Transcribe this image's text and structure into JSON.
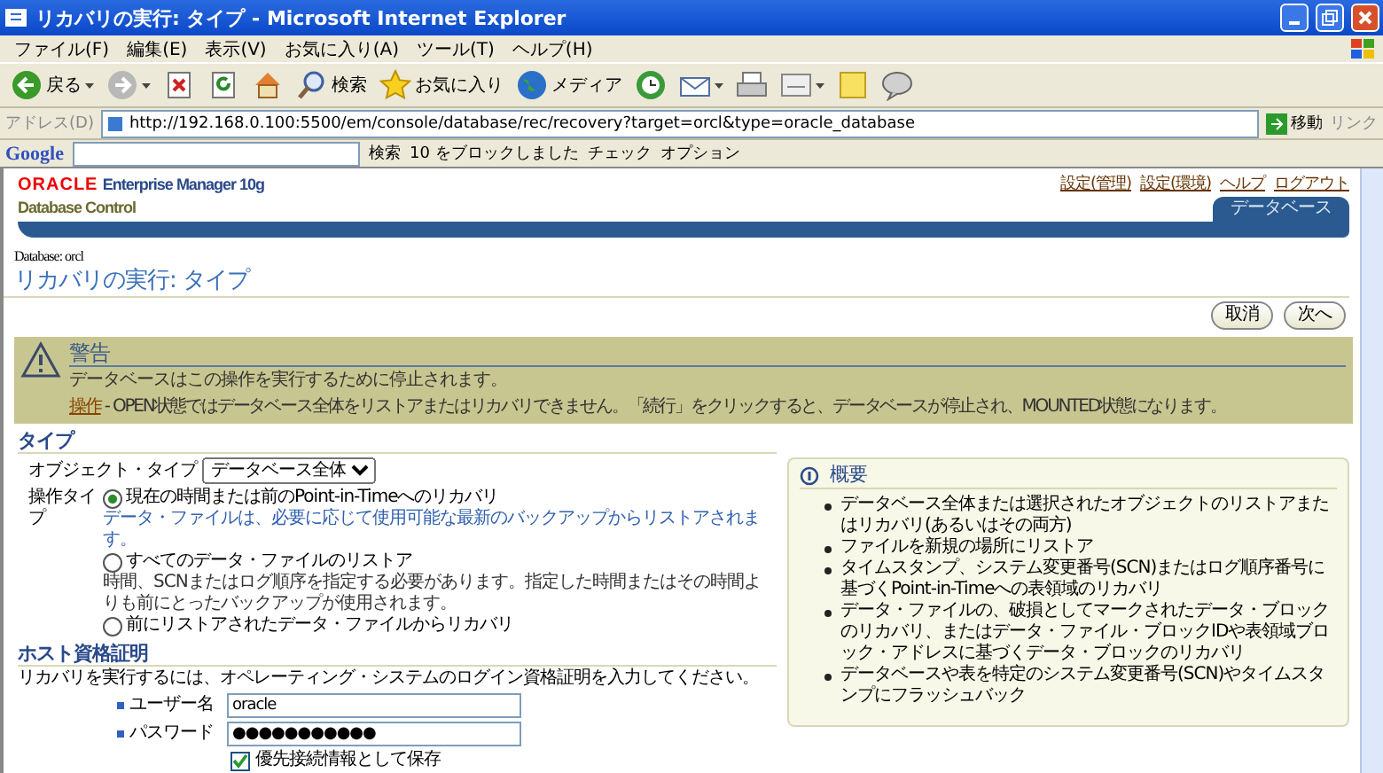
{
  "window": {
    "title": "リカバリの実行: タイプ - Microsoft Internet Explorer"
  },
  "menu": [
    "ファイル(F)",
    "編集(E)",
    "表示(V)",
    "お気に入り(A)",
    "ツール(T)",
    "ヘルプ(H)"
  ],
  "toolbar": [
    {
      "kind": "back",
      "label": "戻る",
      "dropdown": true
    },
    {
      "kind": "forward",
      "dropdown": true
    },
    {
      "kind": "stop"
    },
    {
      "kind": "refresh"
    },
    {
      "kind": "home"
    },
    {
      "kind": "search",
      "label": "検索"
    },
    {
      "kind": "favorites",
      "label": "お気に入り"
    },
    {
      "kind": "media",
      "label": "メディア"
    },
    {
      "kind": "history"
    },
    {
      "kind": "mail",
      "dropdown": true
    },
    {
      "kind": "print"
    },
    {
      "kind": "edit",
      "dropdown": true
    },
    {
      "kind": "note"
    },
    {
      "kind": "messenger"
    }
  ],
  "address": {
    "label": "アドレス(D)",
    "value": "http://192.168.0.100:5500/em/console/database/rec/recovery?target=orcl&type=oracle_database",
    "go": "移動",
    "links": "リンク"
  },
  "google_bar": {
    "brand": "Google",
    "search": "検索",
    "blocked": "10 をブロックしました",
    "check": "チェック",
    "options": "オプション"
  },
  "header": {
    "logo": "ORACLE",
    "product": "Enterprise Manager 10g",
    "subtitle": "Database Control",
    "links": [
      "設定(管理)",
      "設定(環境)",
      "ヘルプ",
      "ログアウト"
    ],
    "tab": "データベース"
  },
  "page": {
    "database": "Database: orcl",
    "title": "リカバリの実行: タイプ",
    "buttons": [
      "取消",
      "次へ"
    ]
  },
  "warning": {
    "title": "警告",
    "message": "データベースはこの操作を実行するために停止されます。",
    "action_label": "操作",
    "action_text": " - OPEN状態ではデータベース全体をリストアまたはリカバリできません。「続行」をクリックすると、データベースが停止され、MOUNTED状態になります。"
  },
  "type_section": {
    "heading": "タイプ",
    "object_type": {
      "label": "オブジェクト・タイプ",
      "value": "データベース全体"
    },
    "operation_label": "操作タイプ",
    "options": [
      {
        "label": "現在の時間または前のPoint-in-Timeへのリカバリ",
        "description": "データ・ファイルは、必要に応じて使用可能な最新のバックアップからリストアされます。",
        "selected": true
      },
      {
        "label": "すべてのデータ・ファイルのリストア",
        "description": "時間、SCNまたはログ順序を指定する必要があります。指定した時間またはその時間よりも前にとったバックアップが使用されます。",
        "selected": false
      },
      {
        "label": "前にリストアされたデータ・ファイルからリカバリ",
        "selected": false
      }
    ]
  },
  "host": {
    "heading": "ホスト資格証明",
    "instruction": "リカバリを実行するには、オペレーティング・システムのログイン資格証明を入力してください。",
    "fields": [
      {
        "label": "ユーザー名",
        "value": "oracle",
        "required": true
      },
      {
        "label": "パスワード",
        "value": "●●●●●●●●●●●",
        "required": true
      }
    ],
    "save": {
      "label": "優先接続情報として保存",
      "checked": true
    }
  },
  "summary": {
    "title": "概要",
    "items": [
      "データベース全体または選択されたオブジェクトのリストアまたはリカバリ(あるいはその両方)",
      "ファイルを新規の場所にリストア",
      "タイムスタンプ、システム変更番号(SCN)またはログ順序番号に基づくPoint-in-Timeへの表領域のリカバリ",
      "データ・ファイルの、破損としてマークされたデータ・ブロックのリカバリ、またはデータ・ファイル・ブロックIDや表領域ブロック・アドレスに基づくデータ・ブロックのリカバリ",
      "データベースや表を特定のシステム変更番号(SCN)やタイムスタンプにフラッシュバック"
    ]
  }
}
